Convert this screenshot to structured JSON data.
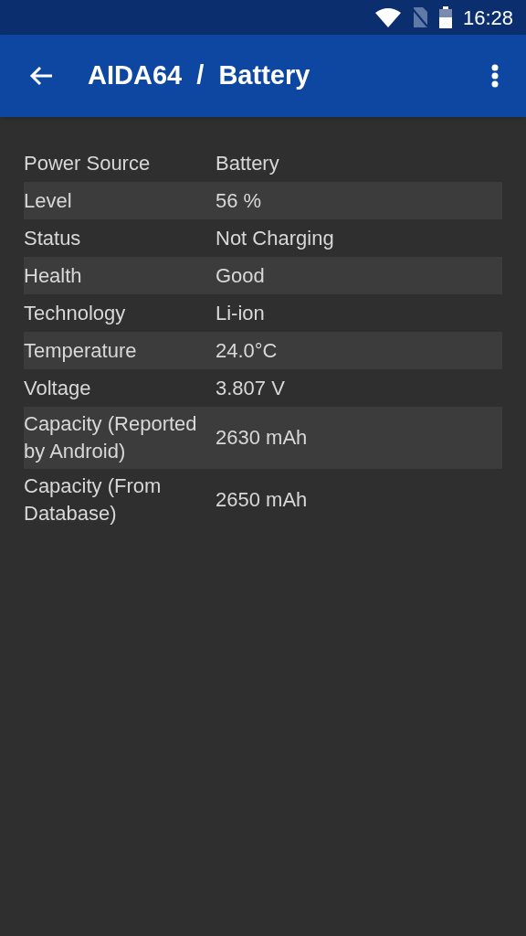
{
  "status_bar": {
    "time": "16:28"
  },
  "app_bar": {
    "title": "AIDA64  /  Battery"
  },
  "rows": [
    {
      "label": "Power Source",
      "value": "Battery"
    },
    {
      "label": "Level",
      "value": "56 %"
    },
    {
      "label": "Status",
      "value": "Not Charging"
    },
    {
      "label": "Health",
      "value": "Good"
    },
    {
      "label": "Technology",
      "value": "Li-ion"
    },
    {
      "label": "Temperature",
      "value": "24.0°C"
    },
    {
      "label": "Voltage",
      "value": "3.807 V"
    },
    {
      "label": "Capacity (Reported by Android)",
      "value": "2630 mAh"
    },
    {
      "label": "Capacity (From Database)",
      "value": "2650 mAh"
    }
  ]
}
